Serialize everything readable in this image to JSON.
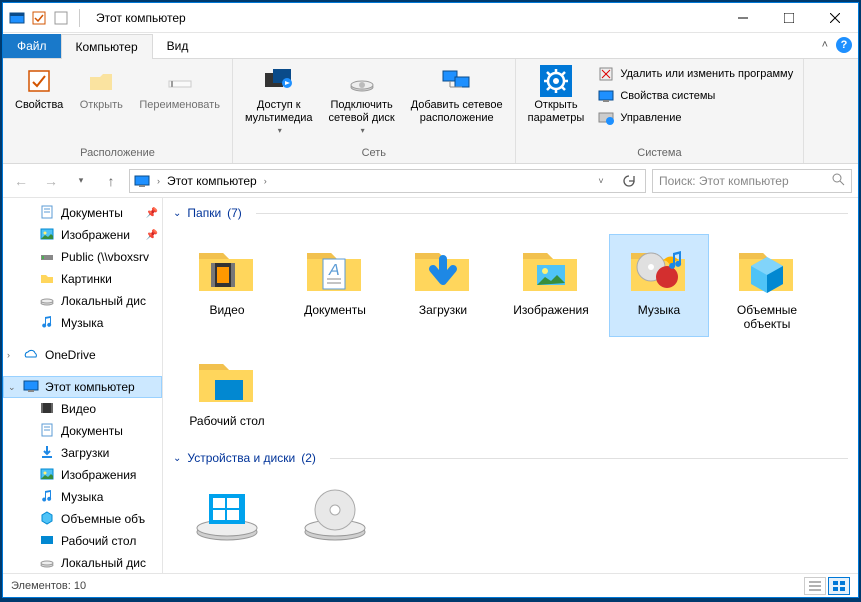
{
  "window": {
    "title": "Этот компьютер"
  },
  "tabs": {
    "file": "Файл",
    "computer": "Компьютер",
    "view": "Вид"
  },
  "ribbon": {
    "group_location": {
      "title": "Расположение",
      "properties": "Свойства",
      "open": "Открыть",
      "rename": "Переименовать"
    },
    "group_network": {
      "title": "Сеть",
      "media": "Доступ к\nмультимедиа",
      "map_drive": "Подключить\nсетевой диск",
      "add_location": "Добавить сетевое\nрасположение"
    },
    "group_system": {
      "title": "Система",
      "open_settings": "Открыть\nпараметры",
      "uninstall": "Удалить или изменить программу",
      "sys_props": "Свойства системы",
      "manage": "Управление"
    }
  },
  "address": {
    "current": "Этот компьютер",
    "search_placeholder": "Поиск: Этот компьютер"
  },
  "sidebar": {
    "quick": [
      {
        "label": "Документы",
        "pinned": true,
        "icon": "doc"
      },
      {
        "label": "Изображени",
        "pinned": true,
        "icon": "pic"
      },
      {
        "label": "Public (\\\\vboxsrv",
        "pinned": false,
        "icon": "net"
      },
      {
        "label": "Картинки",
        "pinned": false,
        "icon": "folder"
      },
      {
        "label": "Локальный дис",
        "pinned": false,
        "icon": "disk"
      },
      {
        "label": "Музыка",
        "pinned": false,
        "icon": "music"
      }
    ],
    "onedrive": "OneDrive",
    "this_pc": "Этот компьютер",
    "pc_children": [
      {
        "label": "Видео",
        "icon": "video"
      },
      {
        "label": "Документы",
        "icon": "doc"
      },
      {
        "label": "Загрузки",
        "icon": "down"
      },
      {
        "label": "Изображения",
        "icon": "pic"
      },
      {
        "label": "Музыка",
        "icon": "music"
      },
      {
        "label": "Объемные объ",
        "icon": "3d"
      },
      {
        "label": "Рабочий стол",
        "icon": "desk"
      },
      {
        "label": "Локальный дис",
        "icon": "disk"
      }
    ]
  },
  "content": {
    "group_folders": {
      "title": "Папки",
      "count": "(7)"
    },
    "folders": [
      {
        "label": "Видео",
        "kind": "video"
      },
      {
        "label": "Документы",
        "kind": "doc"
      },
      {
        "label": "Загрузки",
        "kind": "down"
      },
      {
        "label": "Изображения",
        "kind": "pic"
      },
      {
        "label": "Музыка",
        "kind": "music",
        "selected": true
      },
      {
        "label": "Объемные объекты",
        "kind": "3d"
      },
      {
        "label": "Рабочий стол",
        "kind": "desk"
      }
    ],
    "group_drives": {
      "title": "Устройства и диски",
      "count": "(2)"
    }
  },
  "status": {
    "items": "Элементов: 10"
  }
}
